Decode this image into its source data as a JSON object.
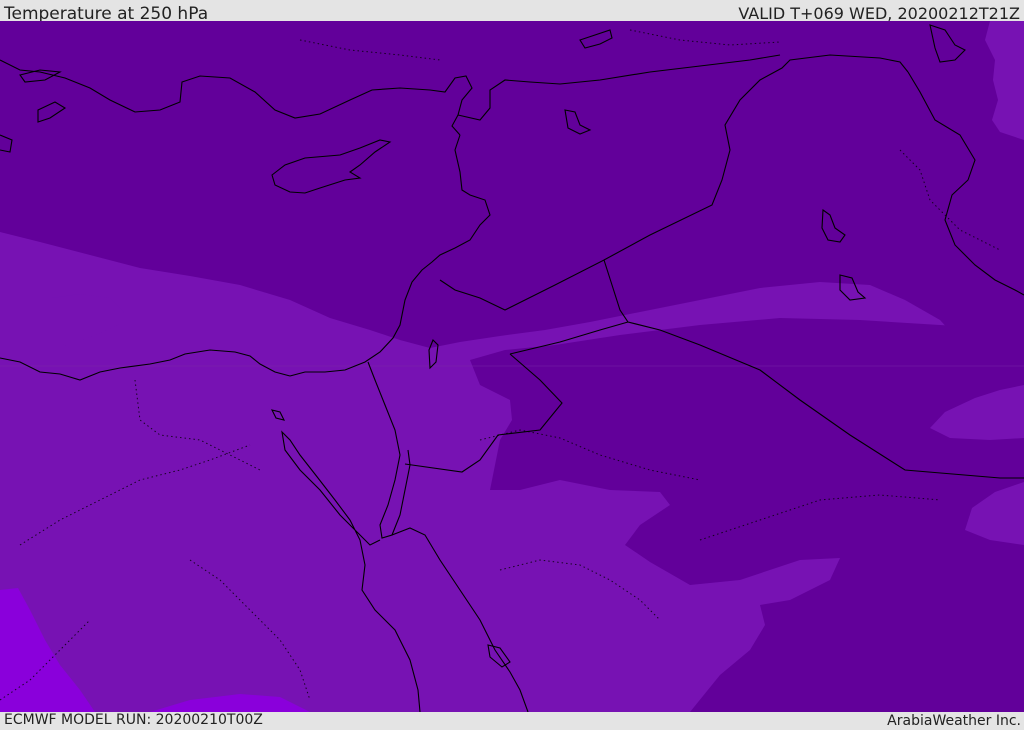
{
  "header": {
    "title": "Temperature at 250 hPa",
    "valid": "VALID T+069 WED, 20200212T21Z"
  },
  "footer": {
    "model_run": "ECMWF MODEL RUN: 20200210T00Z",
    "credit": "ArabiaWeather Inc."
  },
  "colors": {
    "band_cold": "#62009a",
    "band_mid": "#7712b3",
    "band_warm": "#8a00db",
    "coastline": "#000000",
    "frame": "#e4e4e4"
  }
}
